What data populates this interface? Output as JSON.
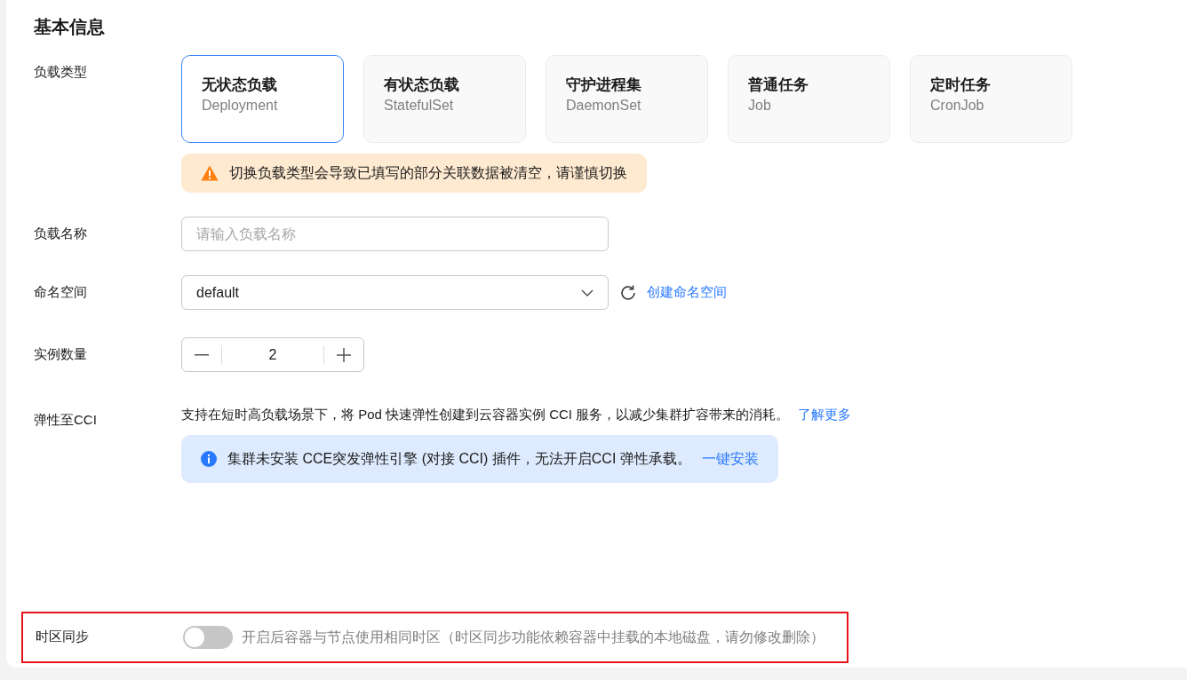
{
  "section_title": "基本信息",
  "workload_type": {
    "label": "负载类型",
    "options": [
      {
        "title": "无状态负载",
        "subtitle": "Deployment",
        "selected": true
      },
      {
        "title": "有状态负载",
        "subtitle": "StatefulSet",
        "selected": false
      },
      {
        "title": "守护进程集",
        "subtitle": "DaemonSet",
        "selected": false
      },
      {
        "title": "普通任务",
        "subtitle": "Job",
        "selected": false
      },
      {
        "title": "定时任务",
        "subtitle": "CronJob",
        "selected": false
      }
    ],
    "warning": "切换负载类型会导致已填写的部分关联数据被清空，请谨慎切换"
  },
  "workload_name": {
    "label": "负载名称",
    "placeholder": "请输入负载名称"
  },
  "namespace": {
    "label": "命名空间",
    "value": "default",
    "link": "创建命名空间"
  },
  "instances": {
    "label": "实例数量",
    "value": "2"
  },
  "cci": {
    "label": "弹性至CCI",
    "description": "支持在短时高负载场景下，将 Pod 快速弹性创建到云容器实例 CCI 服务，以减少集群扩容带来的消耗。",
    "link": "了解更多",
    "info": "集群未安装 CCE突发弹性引擎 (对接 CCI) 插件，无法开启CCI 弹性承载。",
    "info_link": "一键安装"
  },
  "timezone": {
    "label": "时区同步",
    "on": false,
    "description": "开启后容器与节点使用相同时区（时区同步功能依赖容器中挂载的本地磁盘，请勿修改删除）",
    "highlighted": true
  }
}
